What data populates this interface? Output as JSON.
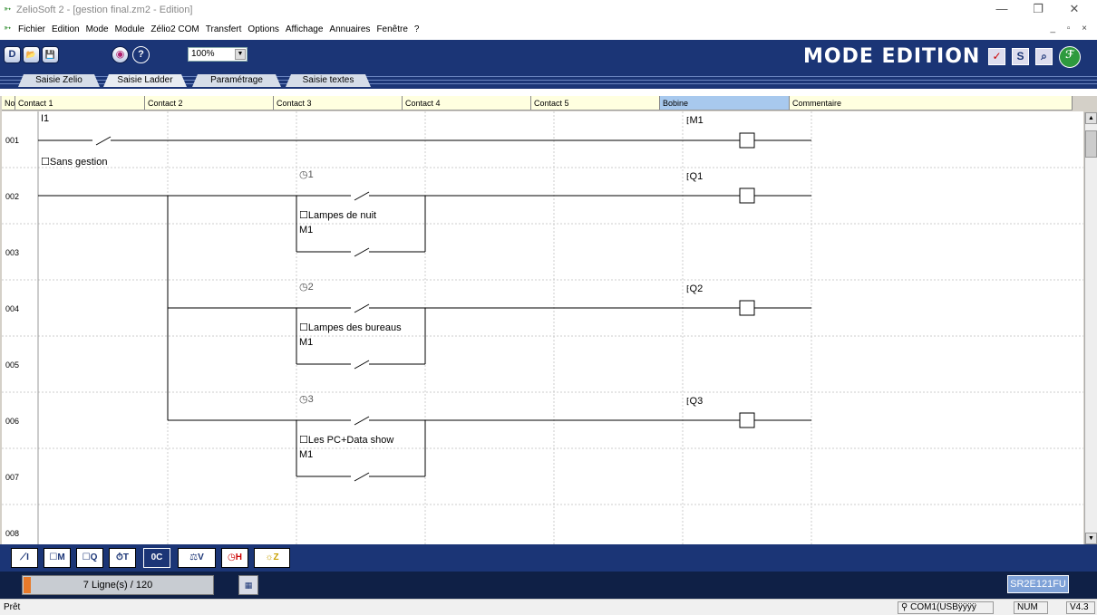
{
  "window": {
    "title": "ZelioSoft 2 - [gestion final.zm2 - Edition]",
    "controls": {
      "minimize": "—",
      "restore": "❐",
      "close": "✕"
    },
    "mdi_controls": "_ ▫ ×"
  },
  "menu": {
    "items": [
      "Fichier",
      "Edition",
      "Mode",
      "Module",
      "Zélio2 COM",
      "Transfert",
      "Options",
      "Affichage",
      "Annuaires",
      "Fenêtre",
      "?"
    ]
  },
  "toolbar": {
    "new_icon": "D",
    "open_icon": "📂",
    "save_icon": "💾",
    "view_icon": "◉",
    "help_icon": "?",
    "zoom_value": "100%",
    "mode_title": "MODE EDITION",
    "mode_btn1": "✓",
    "mode_btn2": "S",
    "mode_btn3": "⌕"
  },
  "tabs": [
    "Saisie Zelio",
    "Saisie Ladder",
    "Paramétrage",
    "Saisie textes"
  ],
  "grid": {
    "headers": [
      "No",
      "Contact 1",
      "Contact 2",
      "Contact 3",
      "Contact 4",
      "Contact 5",
      "Bobine",
      "Commentaire"
    ],
    "rows": [
      "001",
      "002",
      "003",
      "004",
      "005",
      "006",
      "007",
      "008"
    ],
    "contacts": [
      {
        "name": "I1",
        "comment": "Sans  gestion"
      },
      {
        "name": "1",
        "comment": "Lampes de nuit"
      },
      {
        "name": "M1"
      },
      {
        "name": "2",
        "comment": "Lampes des bureaus"
      },
      {
        "name": "M1"
      },
      {
        "name": "3",
        "comment": "Les PC+Data show"
      },
      {
        "name": "M1"
      }
    ],
    "coils": [
      "M1",
      "Q1",
      "Q2",
      "Q3"
    ]
  },
  "palette": {
    "items": [
      "I",
      "M",
      "Q",
      "T",
      "C",
      "V",
      "H",
      "Z"
    ]
  },
  "info": {
    "lines": "7 Ligne(s) / 120",
    "module": "SR2E121FU"
  },
  "status": {
    "text": "Prêt",
    "com": "COM1(USBÿÿÿÿ",
    "num": "NUM",
    "version": "V4.3"
  }
}
